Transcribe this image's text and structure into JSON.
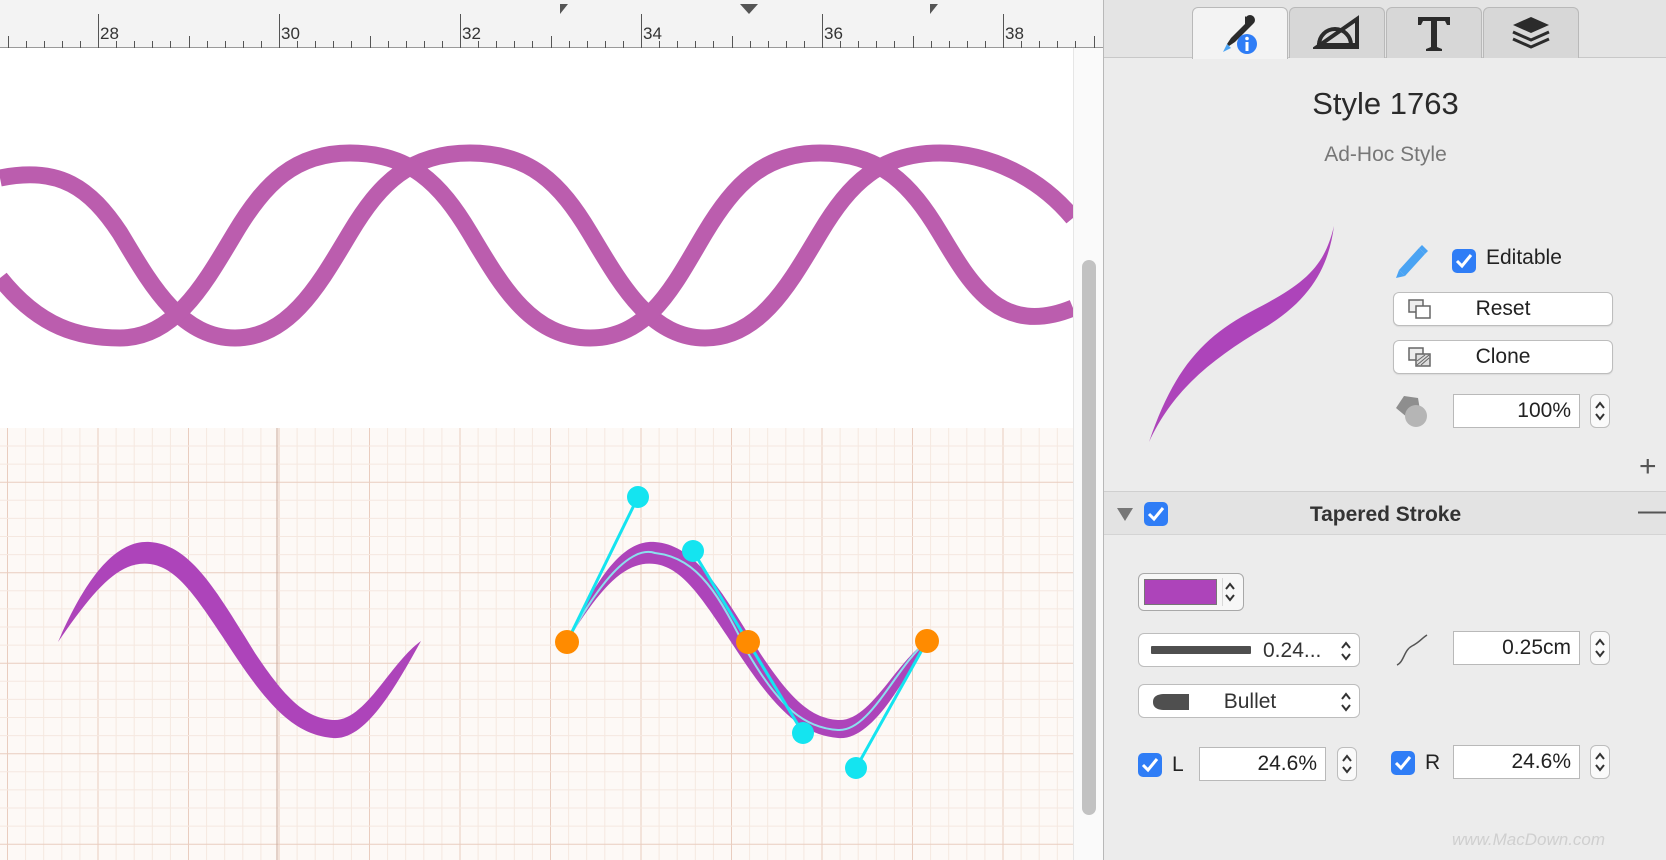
{
  "ruler": {
    "labels": [
      "28",
      "30",
      "32",
      "34",
      "36",
      "38"
    ]
  },
  "colors": {
    "stroke_purple": "#ad44ba",
    "pattern_purple": "#bb5dae",
    "handle_cyan": "#14e4f0",
    "anchor_orange": "#ff8b00",
    "check_blue": "#2f7df6"
  },
  "inspector": {
    "tabs": [
      {
        "name": "style-tab",
        "icon": "eyedropper-info-icon"
      },
      {
        "name": "geometry-tab",
        "icon": "protractor-icon"
      },
      {
        "name": "text-tab",
        "icon": "text-T-icon"
      },
      {
        "name": "layers-tab",
        "icon": "layers-icon"
      }
    ],
    "style_title": "Style 1763",
    "style_subtitle": "Ad-Hoc Style",
    "editable_label": "Editable",
    "reset_label": "Reset",
    "clone_label": "Clone",
    "opacity_value": "100%",
    "add_symbol": "+",
    "remove_symbol": "—",
    "section": {
      "title": "Tapered Stroke",
      "stroke_width_value": "0.24...",
      "smoothness_value": "0.25cm",
      "cap_value": "Bullet",
      "left_label": "L",
      "left_value": "24.6%",
      "right_label": "R",
      "right_value": "24.6%"
    }
  },
  "watermark": "www.MacDown.com"
}
